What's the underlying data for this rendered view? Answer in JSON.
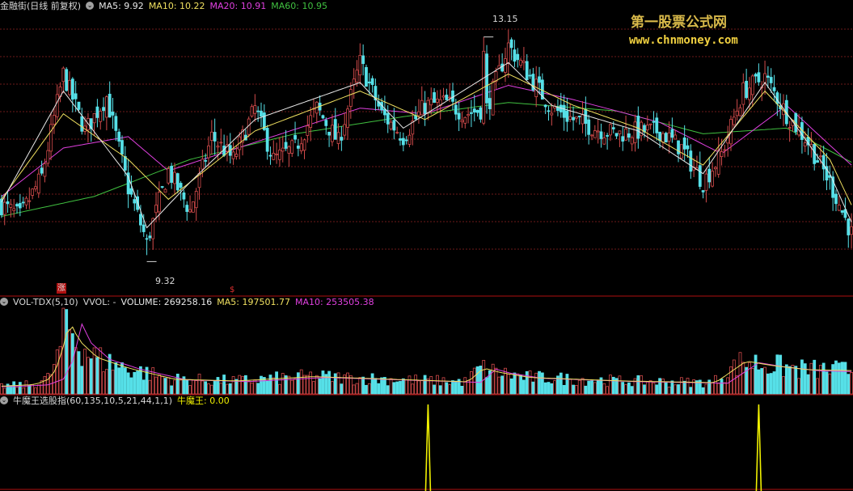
{
  "colors": {
    "up": "#d24b4b",
    "down": "#56e0e8",
    "ma5": "#e8e8e8",
    "ma10": "#f0e060",
    "ma20": "#e040e0",
    "ma60": "#40c040",
    "grid": "#6e1a1a",
    "separator": "#b01010",
    "spike": "#f0f000",
    "label": "#d8d8d8"
  },
  "header": {
    "title": "金融街(日线 前复权)",
    "ma5": "MA5: 9.92",
    "ma10": "MA10: 10.22",
    "ma20": "MA20: 10.91",
    "ma60": "MA60: 10.95"
  },
  "watermark": {
    "line1": "第一股票公式网",
    "line2": "www.chnmoney.com"
  },
  "annotations": {
    "high": "13.15",
    "low": "9.32",
    "mark1": "涨",
    "mark2": "$"
  },
  "vol_header": {
    "name": "VOL-TDX(5,10)",
    "vvol": "VVOL: -",
    "volume": "VOLUME: 269258.16",
    "ma5": "MA5: 197501.77",
    "ma10": "MA10: 253505.38"
  },
  "ind_header": {
    "name": "牛魔王选股指(60,135,10,5,21,44,1,1)",
    "value": "牛魔王: 0.00"
  },
  "chart_data": [
    {
      "type": "candlestick",
      "title": "金融街(日线 前复权)",
      "high": 13.15,
      "low": 9.32,
      "ylim": [
        8.8,
        13.6
      ],
      "close_path": [
        [
          0,
          10.2
        ],
        [
          6,
          10.0
        ],
        [
          13,
          10.7
        ],
        [
          20,
          12.5
        ],
        [
          27,
          11.5
        ],
        [
          34,
          12.1
        ],
        [
          41,
          10.5
        ],
        [
          47,
          9.55
        ],
        [
          54,
          10.8
        ],
        [
          61,
          10.1
        ],
        [
          68,
          11.4
        ],
        [
          75,
          11.0
        ],
        [
          82,
          11.9
        ],
        [
          88,
          11.0
        ],
        [
          95,
          11.2
        ],
        [
          102,
          11.9
        ],
        [
          109,
          11.3
        ],
        [
          116,
          12.7
        ],
        [
          123,
          11.8
        ],
        [
          130,
          11.4
        ],
        [
          137,
          11.95
        ],
        [
          144,
          12.0
        ],
        [
          150,
          11.8
        ],
        [
          157,
          11.9
        ],
        [
          164,
          13.0
        ],
        [
          171,
          12.45
        ],
        [
          178,
          11.9
        ],
        [
          185,
          11.7
        ],
        [
          192,
          11.55
        ],
        [
          199,
          11.45
        ],
        [
          206,
          11.5
        ],
        [
          213,
          11.5
        ],
        [
          220,
          11.2
        ],
        [
          227,
          10.6
        ],
        [
          233,
          11.1
        ],
        [
          240,
          12.2
        ],
        [
          247,
          12.45
        ],
        [
          254,
          11.8
        ],
        [
          261,
          11.3
        ],
        [
          268,
          10.6
        ],
        [
          275,
          9.7
        ]
      ],
      "ma5_path": [
        [
          0,
          10.25
        ],
        [
          20,
          12.2
        ],
        [
          41,
          10.7
        ],
        [
          47,
          9.8
        ],
        [
          61,
          10.6
        ],
        [
          82,
          11.7
        ],
        [
          116,
          12.35
        ],
        [
          130,
          11.55
        ],
        [
          164,
          12.7
        ],
        [
          178,
          11.95
        ],
        [
          206,
          11.5
        ],
        [
          227,
          10.75
        ],
        [
          247,
          12.35
        ],
        [
          268,
          10.75
        ],
        [
          275,
          9.9
        ]
      ],
      "ma10_path": [
        [
          0,
          10.3
        ],
        [
          20,
          11.8
        ],
        [
          41,
          11.0
        ],
        [
          54,
          10.3
        ],
        [
          82,
          11.5
        ],
        [
          116,
          12.2
        ],
        [
          137,
          11.7
        ],
        [
          164,
          12.5
        ],
        [
          185,
          11.95
        ],
        [
          206,
          11.55
        ],
        [
          227,
          10.9
        ],
        [
          247,
          12.2
        ],
        [
          268,
          11.0
        ],
        [
          275,
          10.2
        ]
      ],
      "ma20_path": [
        [
          0,
          10.35
        ],
        [
          20,
          11.2
        ],
        [
          41,
          11.4
        ],
        [
          54,
          10.8
        ],
        [
          82,
          11.3
        ],
        [
          116,
          11.9
        ],
        [
          137,
          11.8
        ],
        [
          164,
          12.3
        ],
        [
          185,
          12.05
        ],
        [
          213,
          11.65
        ],
        [
          233,
          11.1
        ],
        [
          254,
          11.95
        ],
        [
          275,
          10.9
        ]
      ],
      "ma60_path": [
        [
          0,
          10.0
        ],
        [
          30,
          10.35
        ],
        [
          61,
          11.0
        ],
        [
          95,
          11.45
        ],
        [
          130,
          11.75
        ],
        [
          164,
          12.0
        ],
        [
          199,
          11.85
        ],
        [
          227,
          11.45
        ],
        [
          254,
          11.55
        ],
        [
          275,
          10.95
        ]
      ],
      "series": [
        {
          "name": "MA5",
          "value": 9.92
        },
        {
          "name": "MA10",
          "value": 10.22
        },
        {
          "name": "MA20",
          "value": 10.91
        },
        {
          "name": "MA60",
          "value": 10.95
        }
      ]
    },
    {
      "type": "bar",
      "title": "VOL-TDX(5,10)",
      "ylim": [
        0,
        1000000
      ],
      "volume_path": [
        [
          0,
          90000
        ],
        [
          10,
          110000
        ],
        [
          15,
          180000
        ],
        [
          18,
          400000
        ],
        [
          21,
          850000
        ],
        [
          24,
          620000
        ],
        [
          30,
          420000
        ],
        [
          40,
          300000
        ],
        [
          55,
          170000
        ],
        [
          75,
          150000
        ],
        [
          100,
          200000
        ],
        [
          150,
          140000
        ],
        [
          155,
          300000
        ],
        [
          160,
          250000
        ],
        [
          170,
          190000
        ],
        [
          200,
          150000
        ],
        [
          230,
          130000
        ],
        [
          240,
          380000
        ],
        [
          248,
          330000
        ],
        [
          260,
          280000
        ],
        [
          275,
          269258
        ]
      ],
      "series": [
        {
          "name": "VOLUME",
          "value": 269258.16
        },
        {
          "name": "MA5",
          "value": 197501.77
        },
        {
          "name": "MA10",
          "value": 253505.38
        }
      ]
    },
    {
      "type": "line",
      "title": "牛魔王选股指(60,135,10,5,21,44,1,1)",
      "ylim": [
        0,
        1
      ],
      "spikes": [
        138,
        245
      ],
      "series": [
        {
          "name": "牛魔王",
          "value": 0.0
        }
      ]
    }
  ]
}
